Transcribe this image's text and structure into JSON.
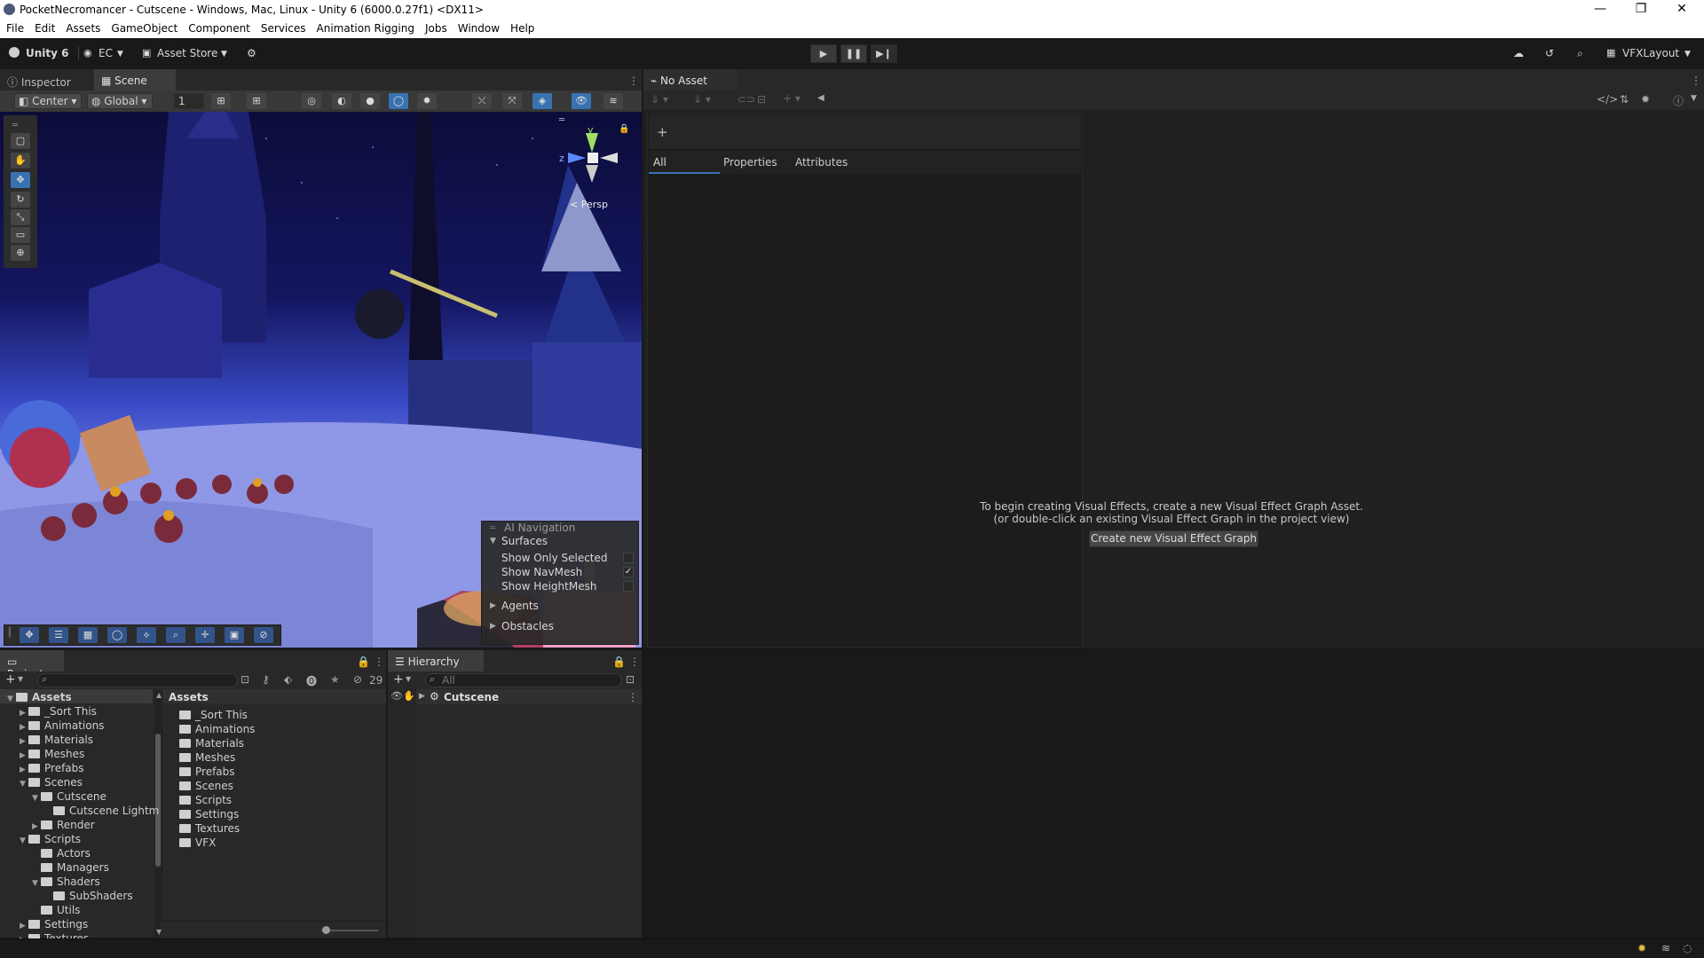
{
  "window": {
    "title": "PocketNecromancer - Cutscene - Windows, Mac, Linux - Unity 6 (6000.0.27f1) <DX11>",
    "controls": [
      "—",
      "❐",
      "✕"
    ]
  },
  "menu": [
    "File",
    "Edit",
    "Assets",
    "GameObject",
    "Component",
    "Services",
    "Animation Rigging",
    "Jobs",
    "Window",
    "Help"
  ],
  "toolbar": {
    "unity_label": "Unity 6",
    "account_label": "EC",
    "asset_store_label": "Asset Store",
    "layout_label": "VFXLayout"
  },
  "left_panel": {
    "tabs": [
      "Inspector",
      "Scene"
    ],
    "pivot_label": "Center",
    "space_label": "Global",
    "grid_value": "1",
    "persp_label": "< Persp",
    "gizmo_y": "y",
    "gizmo_z": "z"
  },
  "ai_nav": {
    "title": "AI Navigation",
    "surfaces": "Surfaces",
    "show_only_selected": "Show Only Selected",
    "show_navmesh": "Show NavMesh",
    "show_heightmesh": "Show HeightMesh",
    "agents": "Agents",
    "obstacles": "Obstacles",
    "show_navmesh_checked": true
  },
  "vfx": {
    "tab": "No Asset",
    "plus": "+",
    "filter_tabs": [
      "All",
      "Properties",
      "Attributes"
    ],
    "message_line1": "To begin creating Visual Effects, create a new Visual Effect Graph Asset.",
    "message_line2": "(or double-click an existing Visual Effect Graph in the project view)",
    "create_button": "Create new Visual Effect Graph"
  },
  "project": {
    "tab": "Project",
    "hidden_count": "29",
    "tree": [
      {
        "label": "Assets",
        "depth": 0,
        "expanded": true,
        "bold": true
      },
      {
        "label": "_Sort This",
        "depth": 1
      },
      {
        "label": "Animations",
        "depth": 1
      },
      {
        "label": "Materials",
        "depth": 1
      },
      {
        "label": "Meshes",
        "depth": 1
      },
      {
        "label": "Prefabs",
        "depth": 1
      },
      {
        "label": "Scenes",
        "depth": 1,
        "expanded": true
      },
      {
        "label": "Cutscene",
        "depth": 2,
        "expanded": true
      },
      {
        "label": "Cutscene Lightm",
        "depth": 3,
        "leaf": true
      },
      {
        "label": "Render",
        "depth": 2
      },
      {
        "label": "Scripts",
        "depth": 1,
        "expanded": true
      },
      {
        "label": "Actors",
        "depth": 2,
        "leaf": true
      },
      {
        "label": "Managers",
        "depth": 2,
        "leaf": true
      },
      {
        "label": "Shaders",
        "depth": 2,
        "expanded": true
      },
      {
        "label": "SubShaders",
        "depth": 3,
        "leaf": true
      },
      {
        "label": "Utils",
        "depth": 2,
        "leaf": true
      },
      {
        "label": "Settings",
        "depth": 1
      },
      {
        "label": "Textures",
        "depth": 1
      }
    ],
    "content_header": "Assets",
    "content": [
      "_Sort This",
      "Animations",
      "Materials",
      "Meshes",
      "Prefabs",
      "Scenes",
      "Scripts",
      "Settings",
      "Textures",
      "VFX"
    ]
  },
  "hierarchy": {
    "tab": "Hierarchy",
    "search_placeholder": "All",
    "scene": "Cutscene"
  },
  "colors": {
    "background": "#191919",
    "panel": "#282828",
    "accent": "#3a72b0"
  }
}
